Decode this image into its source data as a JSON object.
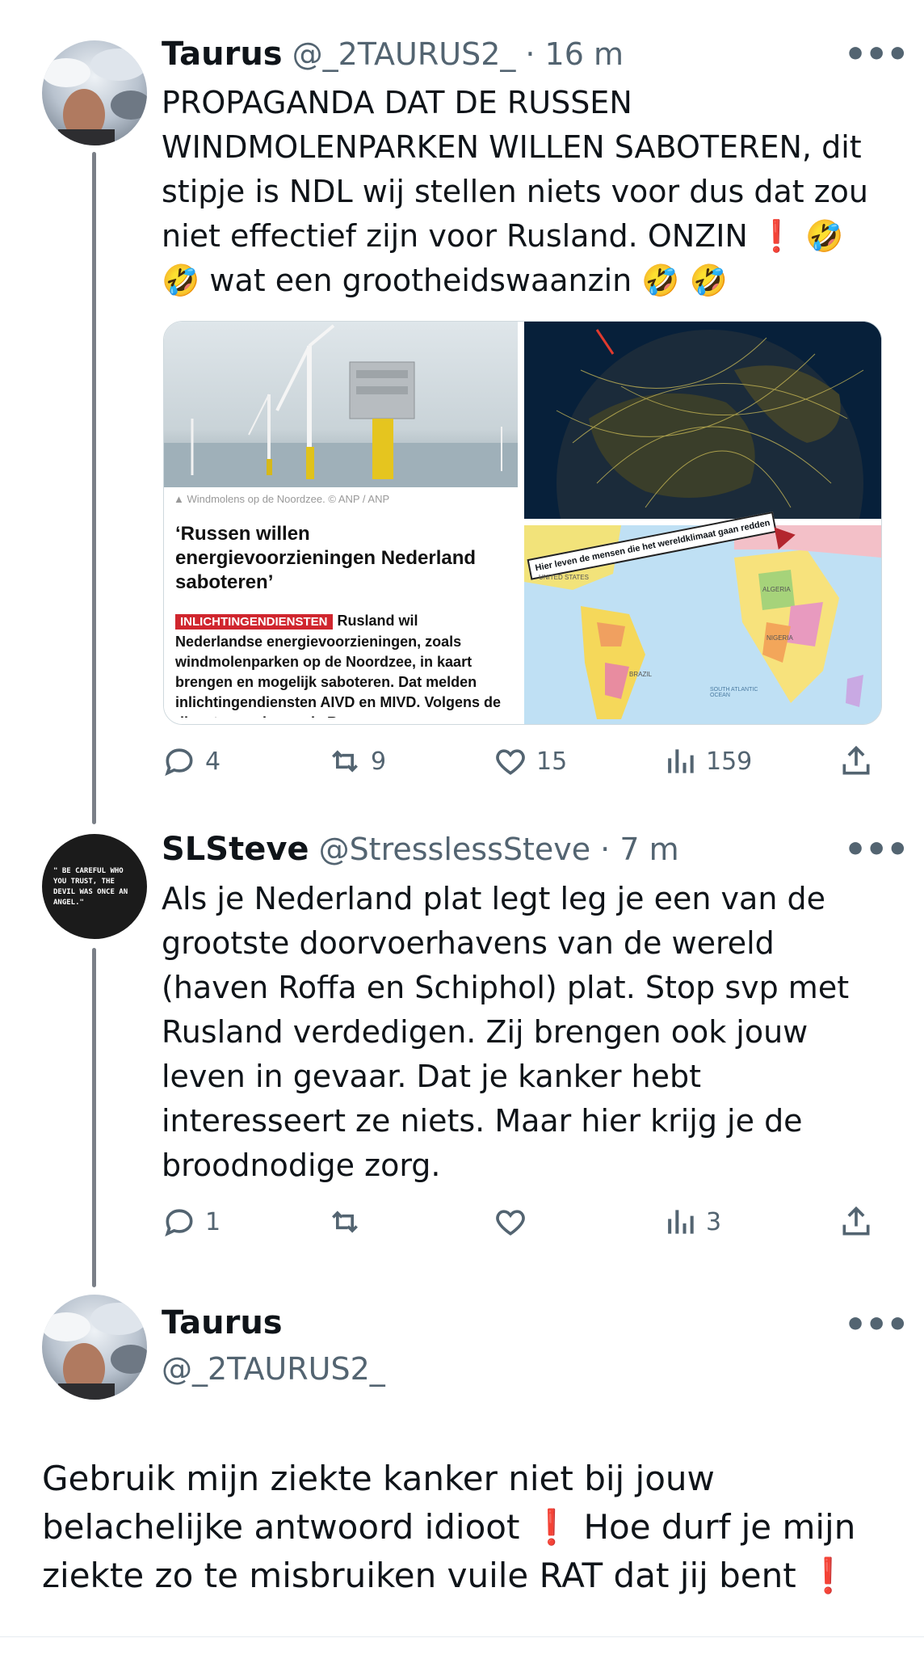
{
  "tweet1": {
    "name": "Taurus",
    "handle": "@_2TAURUS2_",
    "time": "· 16 m",
    "text": "PROPAGANDA DAT DE RUSSEN WINDMOLENPARKEN WILLEN SABOTEREN, dit stipje is NDL wij stellen niets voor dus dat zou niet effectief zijn voor Rusland. ONZIN ❗ 🤣 🤣 wat een grootheidswaanzin 🤣 🤣",
    "media": {
      "news_caption": "▲ Windmolens op de Noordzee. © ANP / ANP",
      "news_title": "‘Russen willen energievoorzieningen Nederland saboteren’",
      "news_tag": "INLICHTINGENDIENSTEN",
      "news_body": "Rusland wil Nederlandse energievoorzieningen, zoals windmolenparken op de Noordzee, in kaart brengen en mogelijk saboteren. Dat melden inlichtingendiensten AIVD en MIVD. Volgens de diensten proberen de Russen meer",
      "map_arrow_text": "Hier leven de mensen die het wereldklimaat gaan redden",
      "map_labels": [
        "UNITED STATES",
        "BRAZIL",
        "SOUTH ATLANTIC OCEAN",
        "ALGERIA",
        "NIGERIA"
      ]
    },
    "actions": {
      "replies": "4",
      "reposts": "9",
      "likes": "15",
      "views": "159"
    }
  },
  "tweet2": {
    "name": "SLSteve",
    "handle": "@StresslessSteve",
    "time": "· 7 m",
    "avatar_text": "\" BE CAREFUL WHO YOU TRUST, THE DEVIL WAS ONCE AN ANGEL.\"",
    "text": "Als je Nederland plat legt leg je een van de grootste doorvoerhavens van de wereld (haven Roffa en Schiphol) plat. Stop svp met Rusland verdedigen. Zij brengen ook jouw leven in gevaar. Dat je kanker hebt interesseert ze niets. Maar hier krijg je de broodnodige zorg.",
    "actions": {
      "replies": "1",
      "reposts": "",
      "likes": "",
      "views": "3"
    }
  },
  "tweet3": {
    "name": "Taurus",
    "handle": "@_2TAURUS2_",
    "text": "Gebruik mijn ziekte kanker niet bij jouw belachelijke antwoord idioot ❗  Hoe durf je mijn ziekte zo te misbruiken vuile RAT dat jij bent ❗"
  },
  "more_label": "•••",
  "colors": {
    "text": "#0f1419",
    "secondary": "#536471",
    "thread": "#7a7f87",
    "alert": "#d0262e"
  }
}
